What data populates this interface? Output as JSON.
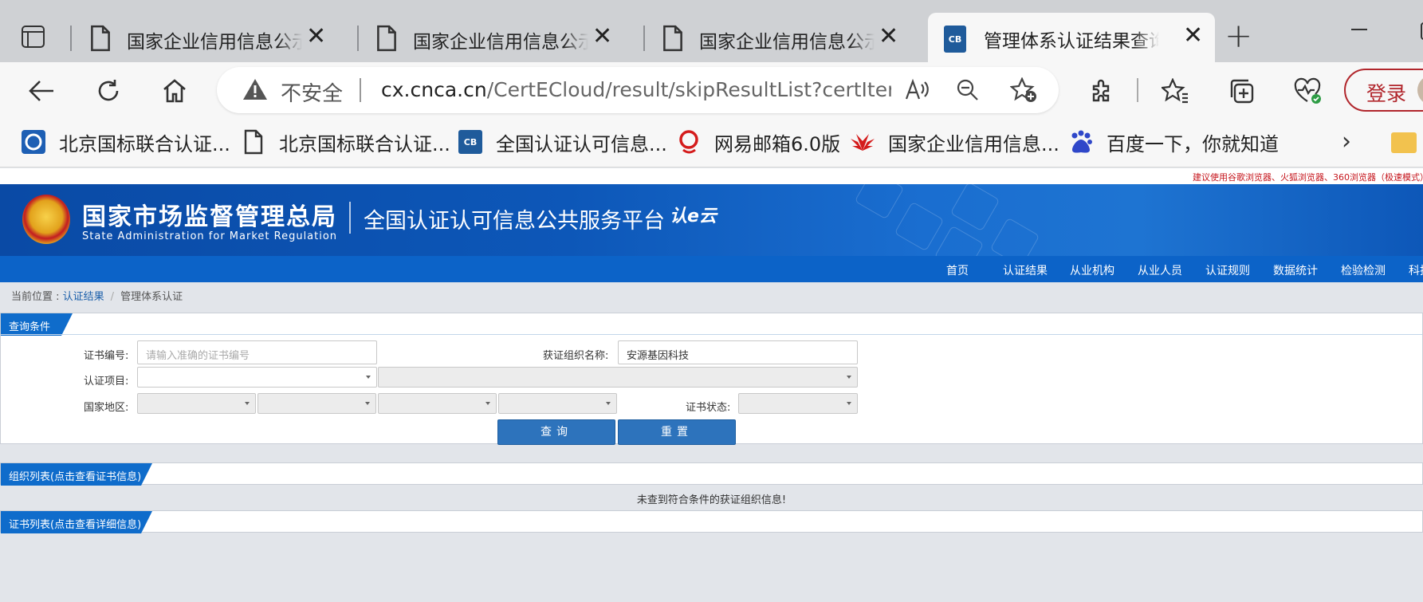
{
  "browser": {
    "tabs": [
      {
        "title": "国家企业信用信息公示系统",
        "icon": "document-icon",
        "active": false
      },
      {
        "title": "国家企业信用信息公示系统",
        "icon": "document-icon",
        "active": false
      },
      {
        "title": "国家企业信用信息公示系统",
        "icon": "document-icon",
        "active": false
      },
      {
        "title": "管理体系认证结果查询系统",
        "icon": "cert-logo-icon",
        "active": true
      }
    ],
    "security_label": "不安全",
    "url_host": "cx.cnca.cn",
    "url_path": "/CertECloud/result/skipResultList?certItem...",
    "login_label": "登录",
    "favorites": [
      {
        "label": "北京国标联合认证...",
        "icon": "bjgb-logo-icon"
      },
      {
        "label": "北京国标联合认证...",
        "icon": "document-icon"
      },
      {
        "label": "全国认证认可信息...",
        "icon": "cert-logo-icon"
      },
      {
        "label": "网易邮箱6.0版",
        "icon": "netease-icon"
      },
      {
        "label": "国家企业信用信息...",
        "icon": "huawei-icon"
      },
      {
        "label": "百度一下，你就知道",
        "icon": "baidu-icon"
      }
    ]
  },
  "site": {
    "notice": "建议使用谷歌浏览器、火狐浏览器、360浏览器（极速模式）",
    "org_name_cn": "国家市场监督管理总局",
    "org_name_en": "State Administration for Market Regulation",
    "platform_name": "全国认证认可信息公共服务平台",
    "platform_logo": "认e云",
    "nav": [
      "首页",
      "认证结果",
      "从业机构",
      "从业人员",
      "认证规则",
      "数据统计",
      "检验检测",
      "科技"
    ],
    "breadcrumb": {
      "prefix": "当前位置 : ",
      "link": "认证结果",
      "current": "管理体系认证"
    },
    "colors": {
      "brand_blue": "#0c63c8",
      "notice_red": "#c5141b",
      "button_blue": "#2d73bc"
    }
  },
  "query": {
    "section_title": "查询条件",
    "cert_no_label": "证书编号:",
    "cert_no_placeholder": "请输入准确的证书编号",
    "org_name_label": "获证组织名称:",
    "org_name_value": "安源基因科技",
    "cert_item_label": "认证项目:",
    "region_label": "国家地区:",
    "status_label": "证书状态:",
    "search_button": "查询",
    "reset_button": "重置"
  },
  "org_list": {
    "section_title": "组织列表(点击查看证书信息)",
    "empty_message": "未查到符合条件的获证组织信息!"
  },
  "cert_list": {
    "section_title": "证书列表(点击查看详细信息)"
  }
}
